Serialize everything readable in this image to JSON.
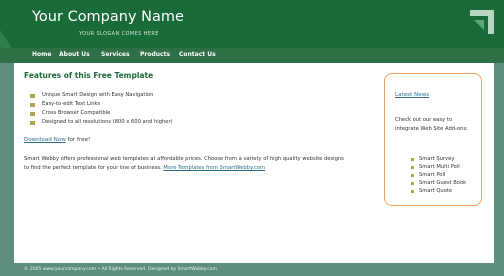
{
  "header": {
    "company_name": "Your Company Name",
    "slogan": "YOUR SLOGAN COMES HERE"
  },
  "nav": {
    "items": [
      {
        "label": "Home"
      },
      {
        "label": "About Us"
      },
      {
        "label": "Services"
      },
      {
        "label": "Products"
      },
      {
        "label": "Contact Us"
      }
    ]
  },
  "main": {
    "title": "Features of this Free Template",
    "bullets": [
      "Unique Smart Design with Easy Navigation",
      "Easy-to-edit Text Links",
      "Cross Browser Compatible",
      "Designed to all resolutions (800 x 600 and higher)"
    ],
    "download_link": "Download Now",
    "download_text": " for free!",
    "body_line1": "Smart Webby offers professional web templates at affordable prices. Choose from a variety of high quality website designs",
    "body_line2_prefix": "to find the perfect template for your line of business. ",
    "body_line2_link": "More Templates from SmartWebby.com"
  },
  "sidebar": {
    "title": "Latest News",
    "text": "Check out our easy to integrate Web Site Add-ons:",
    "items": [
      "Smart Survey",
      "Smart Multi Poll",
      "Smart Poll",
      "Smart Guest Book",
      "Smart Quote"
    ]
  },
  "footer": {
    "text": "© 2005 www.yourcompany.com • All Rights Reserved. Designed by SmartWebby.com"
  }
}
